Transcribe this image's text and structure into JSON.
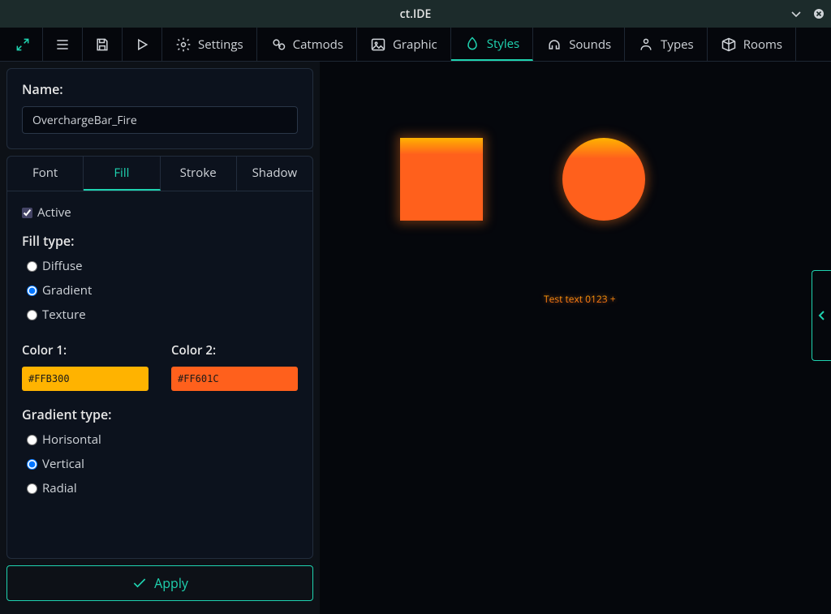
{
  "window": {
    "title": "ct.IDE"
  },
  "toolbar": {
    "settings": "Settings",
    "catmods": "Catmods",
    "graphic": "Graphic",
    "styles": "Styles",
    "sounds": "Sounds",
    "types": "Types",
    "rooms": "Rooms"
  },
  "panel": {
    "name_label": "Name:",
    "name_value": "OverchargeBar_Fire",
    "tabs": {
      "font": "Font",
      "fill": "Fill",
      "stroke": "Stroke",
      "shadow": "Shadow"
    },
    "fill": {
      "active_label": "Active",
      "active_checked": true,
      "fill_type_label": "Fill type:",
      "types": {
        "diffuse": "Diffuse",
        "gradient": "Gradient",
        "texture": "Texture"
      },
      "selected_type": "gradient",
      "color1_label": "Color 1:",
      "color1_value": "#FFB300",
      "color2_label": "Color 2:",
      "color2_value": "#FF601C",
      "gradient_type_label": "Gradient type:",
      "gradient_types": {
        "horisontal": "Horisontal",
        "vertical": "Vertical",
        "radial": "Radial"
      },
      "selected_gradient": "vertical"
    },
    "apply_label": "Apply"
  },
  "preview": {
    "test_text": "Test text 0123 +"
  }
}
